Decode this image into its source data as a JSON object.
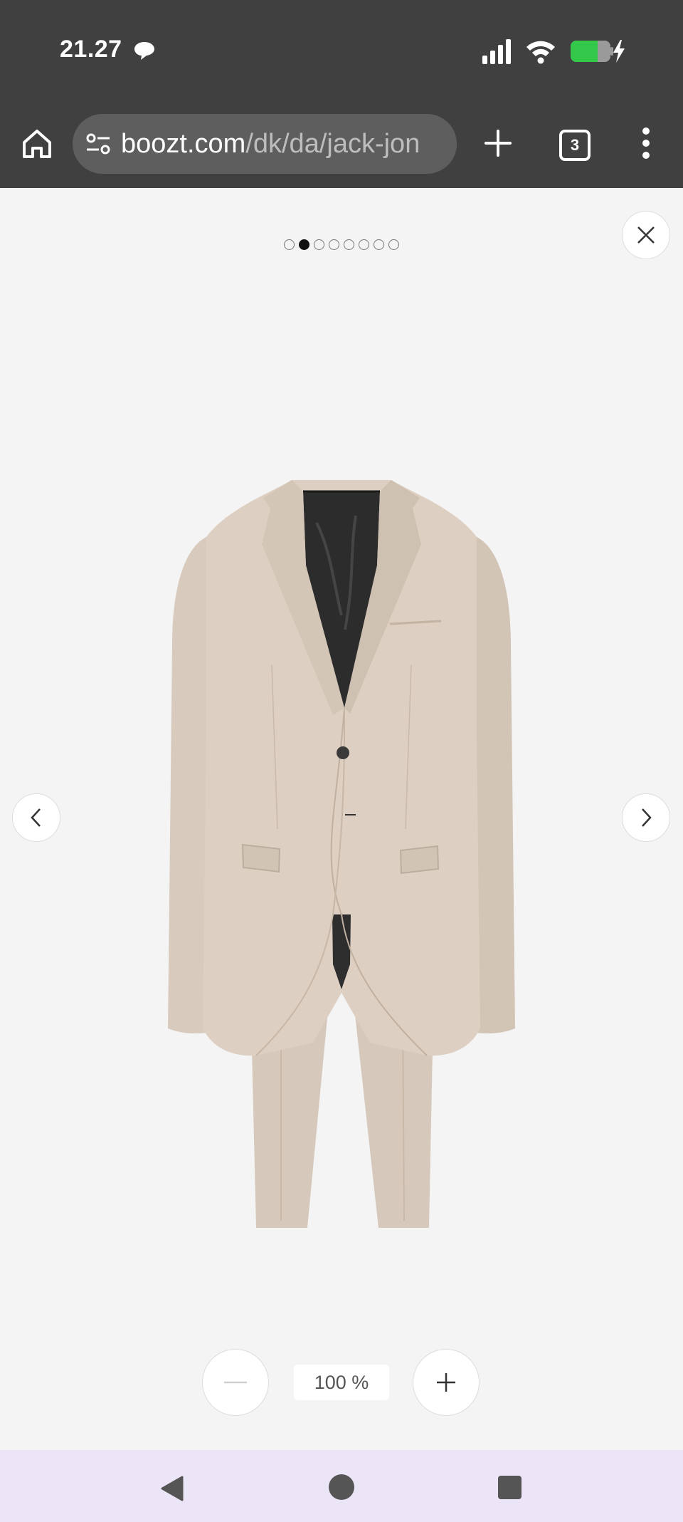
{
  "status_bar": {
    "time": "21.27",
    "icons": [
      "chat-bubble-icon",
      "signal-icon",
      "wifi-icon",
      "battery-charging-icon"
    ],
    "battery_color": "#34c84a"
  },
  "browser": {
    "url_host": "boozt.com",
    "url_path": "/dk/da/jack-jon",
    "tab_count": "3",
    "icons": [
      "home-icon",
      "site-settings-icon",
      "new-tab-plus-icon",
      "more-vert-icon"
    ]
  },
  "gallery": {
    "image_count": 8,
    "active_index": 1,
    "product": "beige two-piece suit, jacket with black lining, trousers",
    "zoom_level": "100 %",
    "icons": [
      "close-icon",
      "chevron-left-icon",
      "chevron-right-icon",
      "minus-icon",
      "plus-icon"
    ]
  },
  "navigation_bar": {
    "icons": [
      "back-triangle-icon",
      "home-circle-icon",
      "recents-square-icon"
    ],
    "background": "#ece4f7"
  }
}
